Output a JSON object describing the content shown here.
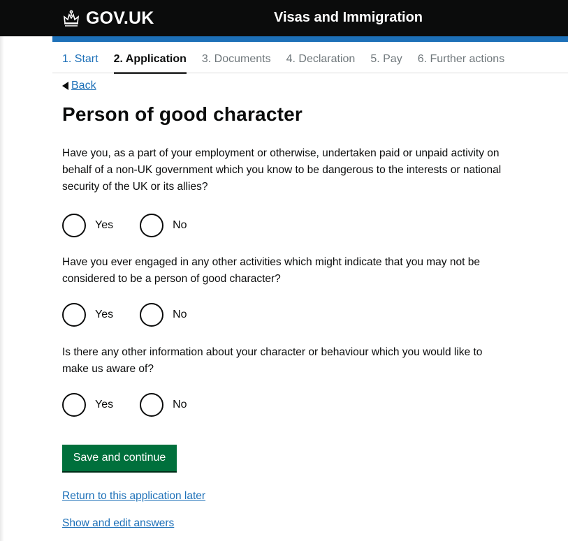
{
  "header": {
    "logo_text": "GOV.UK",
    "logo_icon": "crown-icon",
    "service_name": "Visas and Immigration"
  },
  "steps": [
    {
      "label": "1. Start",
      "state": "done"
    },
    {
      "label": "2. Application",
      "state": "current"
    },
    {
      "label": "3. Documents",
      "state": "todo"
    },
    {
      "label": "4. Declaration",
      "state": "todo"
    },
    {
      "label": "5. Pay",
      "state": "todo"
    },
    {
      "label": "6. Further actions",
      "state": "todo"
    }
  ],
  "back": {
    "label": "Back",
    "icon": "back-arrow-icon"
  },
  "page_title": "Person of good character",
  "questions": [
    {
      "text": "Have you, as a part of your employment or otherwise, undertaken paid or unpaid activity on behalf of a non-UK government which you know to be dangerous to the interests or national security of the UK or its allies?",
      "options": [
        "Yes",
        "No"
      ]
    },
    {
      "text": "Have you ever engaged in any other activities which might indicate that you may not be considered to be a person of good character?",
      "options": [
        "Yes",
        "No"
      ]
    },
    {
      "text": "Is there any other information about your character or behaviour which you would like to make us aware of?",
      "options": [
        "Yes",
        "No"
      ]
    }
  ],
  "actions": {
    "save_label": "Save and continue",
    "return_label": "Return to this application later",
    "show_edit_label": "Show and edit answers"
  },
  "colors": {
    "header": "#0b0c0c",
    "brand_blue": "#1d70b8",
    "button_green": "#00703c",
    "text": "#0b0c0c",
    "muted": "#6f777b"
  }
}
